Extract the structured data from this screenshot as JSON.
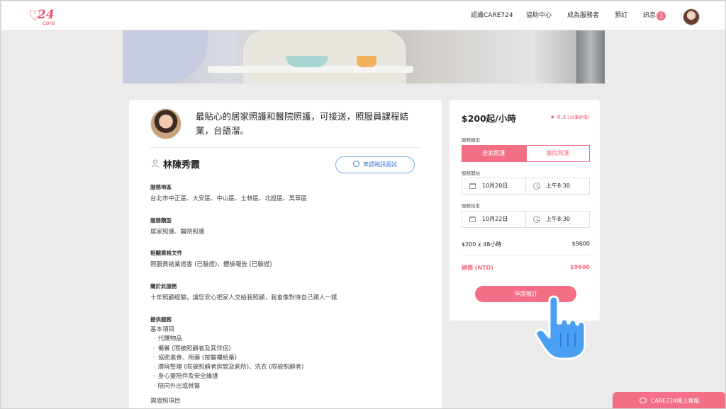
{
  "header": {
    "logo": {
      "number": "24",
      "sub": "care"
    },
    "nav": [
      {
        "key": "about",
        "label": "認識CARE724"
      },
      {
        "key": "help",
        "label": "協助中心"
      },
      {
        "key": "become",
        "label": "成為服務者"
      },
      {
        "key": "booking",
        "label": "預訂"
      },
      {
        "key": "messages",
        "label": "訊息"
      }
    ],
    "message_count": "3"
  },
  "hero": {
    "slides": 3,
    "active_slide": 1
  },
  "profile": {
    "headline": "最貼心的居家照護和醫院照護，可接送，照服員課程結業，台語溜。",
    "name": "林陳秀霞",
    "video_button": "申請視訊面試",
    "sections": {
      "area": {
        "title": "服務地區",
        "text": "台北市中正區、大安區、中山區、士林區、北投區、萬華區"
      },
      "type": {
        "title": "服務類型",
        "text": "居家照護、醫院照護"
      },
      "docs": {
        "title": "相關資格文件",
        "text": "照服員結業證書 (已驗證)、體檢報告 (已驗證)"
      },
      "about": {
        "title": "關於此服務",
        "text": "十年照顧經驗，讓您安心把家人交給我照顧，我會像對待自己親人一樣"
      },
      "provided": {
        "title": "提供服務",
        "basic_title": "基本項目",
        "items": [
          "代購物品",
          "備餐 (限被照顧者及其伴侶)",
          "協助進食、用藥 (按醫囑給藥)",
          "環境整理 (限被照顧者房間及廁所)、洗衣 (限被照顧者)",
          "身心靈陪伴及安全維護",
          "陪同外出或就醫"
        ],
        "more_title": "需證照項目"
      }
    }
  },
  "booking": {
    "price": "$200起/小時",
    "rating": "★ 4.3",
    "review_count": "(10筆評價)",
    "service_type_label": "服務類型",
    "service_types": [
      "居家照護",
      "醫院照護"
    ],
    "selected_service_type": "居家照護",
    "start_label": "服務開始",
    "start_date": "10月20日",
    "start_time": "上午8:30",
    "end_label": "服務結束",
    "end_date": "10月22日",
    "end_time": "上午8:30",
    "calc_label": "$200 x 48小時",
    "calc_value": "$9600",
    "total_label": "總價 (NTD)",
    "total_value": "$9600",
    "submit_label": "申請預訂"
  },
  "chat": {
    "label": "CARE724線上客服"
  },
  "colors": {
    "accent": "#f36f85",
    "link_blue": "#3a78d4",
    "cursor_blue": "#4a9ff5"
  }
}
